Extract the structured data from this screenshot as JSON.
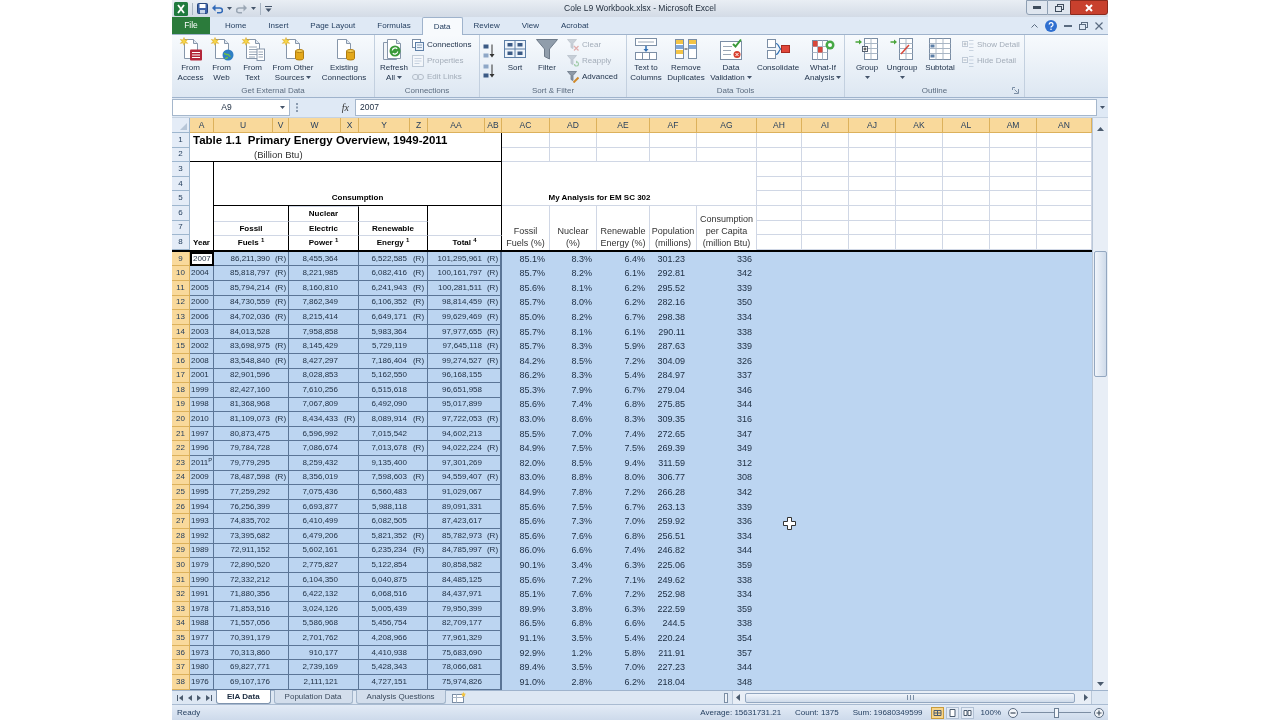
{
  "window": {
    "title": "Cole L9 Workbook.xlsx - Microsoft Excel"
  },
  "ribbon": {
    "tabs": [
      {
        "label": "File",
        "kind": "file",
        "selected": false
      },
      {
        "label": "Home",
        "kind": "tab",
        "selected": false
      },
      {
        "label": "Insert",
        "kind": "tab",
        "selected": false
      },
      {
        "label": "Page Layout",
        "kind": "tab",
        "selected": false
      },
      {
        "label": "Formulas",
        "kind": "tab",
        "selected": false
      },
      {
        "label": "Data",
        "kind": "tab",
        "selected": true
      },
      {
        "label": "Review",
        "kind": "tab",
        "selected": false
      },
      {
        "label": "View",
        "kind": "tab",
        "selected": false
      },
      {
        "label": "Acrobat",
        "kind": "tab",
        "selected": false
      }
    ],
    "groups": [
      {
        "label": "Get External Data",
        "launcher": false,
        "buttons": [
          {
            "label": "From Access",
            "kind": "large",
            "disabled": false
          },
          {
            "label": "From Web",
            "kind": "large",
            "disabled": false
          },
          {
            "label": "From Text",
            "kind": "large",
            "disabled": false
          },
          {
            "label": "From Other Sources",
            "kind": "menu",
            "disabled": false
          },
          {
            "label": "Existing Connections",
            "kind": "large",
            "disabled": false
          }
        ]
      },
      {
        "label": "Connections",
        "launcher": false,
        "buttons": [
          {
            "label": "Refresh All",
            "kind": "menu",
            "disabled": false
          },
          {
            "label": "Connections",
            "kind": "small",
            "disabled": false
          },
          {
            "label": "Properties",
            "kind": "small",
            "disabled": true
          },
          {
            "label": "Edit Links",
            "kind": "small",
            "disabled": true
          }
        ]
      },
      {
        "label": "Sort & Filter",
        "launcher": false,
        "buttons": [
          {
            "kind": "icon",
            "disabled": false
          },
          {
            "kind": "icon",
            "disabled": false
          },
          {
            "label": "Sort",
            "kind": "large",
            "disabled": false
          },
          {
            "label": "Filter",
            "kind": "large",
            "disabled": false
          },
          {
            "label": "Clear",
            "kind": "small",
            "disabled": true
          },
          {
            "label": "Reapply",
            "kind": "small",
            "disabled": true
          },
          {
            "label": "Advanced",
            "kind": "small",
            "disabled": false
          }
        ]
      },
      {
        "label": "Data Tools",
        "launcher": false,
        "buttons": [
          {
            "label": "Text to Columns",
            "kind": "large",
            "disabled": false
          },
          {
            "label": "Remove Duplicates",
            "kind": "large",
            "disabled": false
          },
          {
            "label": "Data Validation",
            "kind": "menu",
            "disabled": false
          },
          {
            "label": "Consolidate",
            "kind": "large",
            "disabled": false
          },
          {
            "label": "What-If Analysis",
            "kind": "menu",
            "disabled": false
          }
        ]
      },
      {
        "label": "Outline",
        "launcher": true,
        "buttons": [
          {
            "label": "Group",
            "kind": "split",
            "disabled": false
          },
          {
            "label": "Ungroup",
            "kind": "split",
            "disabled": false
          },
          {
            "label": "Subtotal",
            "kind": "large",
            "disabled": false
          },
          {
            "label": "Show Detail",
            "kind": "small",
            "disabled": true
          },
          {
            "label": "Hide Detail",
            "kind": "small",
            "disabled": true
          }
        ]
      }
    ]
  },
  "formula_bar": {
    "name_box": "A9",
    "function_label": "fx",
    "value": "2007"
  },
  "sheet": {
    "columns": [
      {
        "label": "A",
        "selected": true
      },
      {
        "label": "U",
        "selected": true
      },
      {
        "label": "V",
        "selected": true
      },
      {
        "label": "W",
        "selected": true
      },
      {
        "label": "X",
        "selected": true
      },
      {
        "label": "Y",
        "selected": true
      },
      {
        "label": "Z",
        "selected": true
      },
      {
        "label": "AA",
        "selected": true
      },
      {
        "label": "AB",
        "selected": true
      },
      {
        "label": "AC",
        "selected": true
      },
      {
        "label": "AD",
        "selected": true
      },
      {
        "label": "AE",
        "selected": true
      },
      {
        "label": "AF",
        "selected": true
      },
      {
        "label": "AG",
        "selected": true
      },
      {
        "label": "AH",
        "selected": true
      },
      {
        "label": "AI",
        "selected": true
      },
      {
        "label": "AJ",
        "selected": true
      },
      {
        "label": "AK",
        "selected": true
      },
      {
        "label": "AL",
        "selected": true
      },
      {
        "label": "AM",
        "selected": true
      },
      {
        "label": "AN",
        "selected": true
      }
    ],
    "header_rows": [
      {
        "label": "1",
        "selected": false
      },
      {
        "label": "2",
        "selected": false
      },
      {
        "label": "3",
        "selected": false
      },
      {
        "label": "4",
        "selected": false
      },
      {
        "label": "5",
        "selected": false
      },
      {
        "label": "6",
        "selected": false
      },
      {
        "label": "7",
        "selected": false
      },
      {
        "label": "8",
        "selected": false
      }
    ],
    "title": "Table 1.1  Primary Energy Overview, 1949-2011",
    "subtitle": "(Billion Btu)",
    "year_label": "Year",
    "group_label": "Consumption",
    "source_columns": [
      {
        "lines": [
          "Fossil",
          "Fuels $^{1}$"
        ]
      },
      {
        "lines": [
          "Nuclear",
          "Electric",
          "Power $^{1}$"
        ]
      },
      {
        "lines": [
          "Renewable",
          "Energy $^{1}$"
        ]
      },
      {
        "lines": [
          "Total $^{4}$"
        ]
      }
    ],
    "analysis_title": "My Analysis for EM SC 302",
    "analysis_columns": [
      "Fossil Fuels (%)",
      "Nuclear (%)",
      "Renewable Energy (%)",
      "Population (millions)",
      "Consumption per Capita (million Btu)"
    ],
    "rows": [
      {
        "row_number": "9",
        "year": "2007",
        "fossil": "86,211,390",
        "fossil_note": "(R)",
        "nuclear": "8,455,364",
        "renewable": "6,522,585",
        "renewable_note": "(R)",
        "total": "101,295,961",
        "total_note": "(R)",
        "fossil_pct": "85.1%",
        "nuclear_pct": "8.3%",
        "renewable_pct": "6.4%",
        "population": "301.23",
        "per_capita": "336",
        "selected": true,
        "active": true
      },
      {
        "row_number": "10",
        "year": "2004",
        "fossil": "85,818,797",
        "fossil_note": "(R)",
        "nuclear": "8,221,985",
        "renewable": "6,082,416",
        "renewable_note": "(R)",
        "total": "100,161,797",
        "total_note": "(R)",
        "fossil_pct": "85.7%",
        "nuclear_pct": "8.2%",
        "renewable_pct": "6.1%",
        "population": "292.81",
        "per_capita": "342",
        "selected": true,
        "active": false
      },
      {
        "row_number": "11",
        "year": "2005",
        "fossil": "85,794,214",
        "fossil_note": "(R)",
        "nuclear": "8,160,810",
        "renewable": "6,241,943",
        "renewable_note": "(R)",
        "total": "100,281,511",
        "total_note": "(R)",
        "fossil_pct": "85.6%",
        "nuclear_pct": "8.1%",
        "renewable_pct": "6.2%",
        "population": "295.52",
        "per_capita": "339",
        "selected": true,
        "active": false
      },
      {
        "row_number": "12",
        "year": "2000",
        "fossil": "84,730,559",
        "fossil_note": "(R)",
        "nuclear": "7,862,349",
        "renewable": "6,106,352",
        "renewable_note": "(R)",
        "total": "98,814,459",
        "total_note": "(R)",
        "fossil_pct": "85.7%",
        "nuclear_pct": "8.0%",
        "renewable_pct": "6.2%",
        "population": "282.16",
        "per_capita": "350",
        "selected": true,
        "active": false
      },
      {
        "row_number": "13",
        "year": "2006",
        "fossil": "84,702,036",
        "fossil_note": "(R)",
        "nuclear": "8,215,414",
        "renewable": "6,649,171",
        "renewable_note": "(R)",
        "total": "99,629,469",
        "total_note": "(R)",
        "fossil_pct": "85.0%",
        "nuclear_pct": "8.2%",
        "renewable_pct": "6.7%",
        "population": "298.38",
        "per_capita": "334",
        "selected": true,
        "active": false
      },
      {
        "row_number": "14",
        "year": "2003",
        "fossil": "84,013,528",
        "nuclear": "7,958,858",
        "renewable": "5,983,364",
        "total": "97,977,655",
        "total_note": "(R)",
        "fossil_pct": "85.7%",
        "nuclear_pct": "8.1%",
        "renewable_pct": "6.1%",
        "population": "290.11",
        "per_capita": "338",
        "selected": true,
        "active": false
      },
      {
        "row_number": "15",
        "year": "2002",
        "fossil": "83,698,975",
        "fossil_note": "(R)",
        "nuclear": "8,145,429",
        "renewable": "5,729,119",
        "total": "97,645,118",
        "total_note": "(R)",
        "fossil_pct": "85.7%",
        "nuclear_pct": "8.3%",
        "renewable_pct": "5.9%",
        "population": "287.63",
        "per_capita": "339",
        "selected": true,
        "active": false
      },
      {
        "row_number": "16",
        "year": "2008",
        "fossil": "83,548,840",
        "fossil_note": "(R)",
        "nuclear": "8,427,297",
        "renewable": "7,186,404",
        "renewable_note": "(R)",
        "total": "99,274,527",
        "total_note": "(R)",
        "fossil_pct": "84.2%",
        "nuclear_pct": "8.5%",
        "renewable_pct": "7.2%",
        "population": "304.09",
        "per_capita": "326",
        "selected": true,
        "active": false
      },
      {
        "row_number": "17",
        "year": "2001",
        "fossil": "82,901,596",
        "nuclear": "8,028,853",
        "renewable": "5,162,550",
        "total": "96,168,155",
        "fossil_pct": "86.2%",
        "nuclear_pct": "8.3%",
        "renewable_pct": "5.4%",
        "population": "284.97",
        "per_capita": "337",
        "selected": true,
        "active": false
      },
      {
        "row_number": "18",
        "year": "1999",
        "fossil": "82,427,160",
        "nuclear": "7,610,256",
        "renewable": "6,515,618",
        "total": "96,651,958",
        "fossil_pct": "85.3%",
        "nuclear_pct": "7.9%",
        "renewable_pct": "6.7%",
        "population": "279.04",
        "per_capita": "346",
        "selected": true,
        "active": false
      },
      {
        "row_number": "19",
        "year": "1998",
        "fossil": "81,368,968",
        "nuclear": "7,067,809",
        "renewable": "6,492,090",
        "total": "95,017,899",
        "fossil_pct": "85.6%",
        "nuclear_pct": "7.4%",
        "renewable_pct": "6.8%",
        "population": "275.85",
        "per_capita": "344",
        "selected": true,
        "active": false
      },
      {
        "row_number": "20",
        "year": "2010",
        "fossil": "81,109,073",
        "fossil_note": "(R)",
        "nuclear": "8,434,433",
        "nuclear_note": "(R)",
        "renewable": "8,089,914",
        "renewable_note": "(R)",
        "total": "97,722,053",
        "total_note": "(R)",
        "fossil_pct": "83.0%",
        "nuclear_pct": "8.6%",
        "renewable_pct": "8.3%",
        "population": "309.35",
        "per_capita": "316",
        "selected": true,
        "active": false
      },
      {
        "row_number": "21",
        "year": "1997",
        "fossil": "80,873,475",
        "nuclear": "6,596,992",
        "renewable": "7,015,542",
        "total": "94,602,213",
        "fossil_pct": "85.5%",
        "nuclear_pct": "7.0%",
        "renewable_pct": "7.4%",
        "population": "272.65",
        "per_capita": "347",
        "selected": true,
        "active": false
      },
      {
        "row_number": "22",
        "year": "1996",
        "fossil": "79,784,728",
        "nuclear": "7,086,674",
        "renewable": "7,013,678",
        "renewable_note": "(R)",
        "total": "94,022,224",
        "total_note": "(R)",
        "fossil_pct": "84.9%",
        "nuclear_pct": "7.5%",
        "renewable_pct": "7.5%",
        "population": "269.39",
        "per_capita": "349",
        "selected": true,
        "active": false
      },
      {
        "row_number": "23",
        "year": "2011$^{P}$",
        "fossil": "79,779,295",
        "nuclear": "8,259,432",
        "renewable": "9,135,400",
        "total": "97,301,269",
        "fossil_pct": "82.0%",
        "nuclear_pct": "8.5%",
        "renewable_pct": "9.4%",
        "population": "311.59",
        "per_capita": "312",
        "selected": true,
        "active": false
      },
      {
        "row_number": "24",
        "year": "2009",
        "fossil": "78,487,598",
        "fossil_note": "(R)",
        "nuclear": "8,356,019",
        "renewable": "7,598,603",
        "renewable_note": "(R)",
        "total": "94,559,407",
        "total_note": "(R)",
        "fossil_pct": "83.0%",
        "nuclear_pct": "8.8%",
        "renewable_pct": "8.0%",
        "population": "306.77",
        "per_capita": "308",
        "selected": true,
        "active": false
      },
      {
        "row_number": "25",
        "year": "1995",
        "fossil": "77,259,292",
        "nuclear": "7,075,436",
        "renewable": "6,560,483",
        "total": "91,029,067",
        "fossil_pct": "84.9%",
        "nuclear_pct": "7.8%",
        "renewable_pct": "7.2%",
        "population": "266.28",
        "per_capita": "342",
        "selected": true,
        "active": false
      },
      {
        "row_number": "26",
        "year": "1994",
        "fossil": "76,256,399",
        "nuclear": "6,693,877",
        "renewable": "5,988,118",
        "total": "89,091,331",
        "fossil_pct": "85.6%",
        "nuclear_pct": "7.5%",
        "renewable_pct": "6.7%",
        "population": "263.13",
        "per_capita": "339",
        "selected": true,
        "active": false
      },
      {
        "row_number": "27",
        "year": "1993",
        "fossil": "74,835,702",
        "nuclear": "6,410,499",
        "renewable": "6,082,505",
        "total": "87,423,617",
        "fossil_pct": "85.6%",
        "nuclear_pct": "7.3%",
        "renewable_pct": "7.0%",
        "population": "259.92",
        "per_capita": "336",
        "selected": true,
        "active": false
      },
      {
        "row_number": "28",
        "year": "1992",
        "fossil": "73,395,682",
        "nuclear": "6,479,206",
        "renewable": "5,821,352",
        "renewable_note": "(R)",
        "total": "85,782,973",
        "total_note": "(R)",
        "fossil_pct": "85.6%",
        "nuclear_pct": "7.6%",
        "renewable_pct": "6.8%",
        "population": "256.51",
        "per_capita": "334",
        "selected": true,
        "active": false
      },
      {
        "row_number": "29",
        "year": "1989",
        "fossil": "72,911,152",
        "nuclear": "5,602,161",
        "renewable": "6,235,234",
        "renewable_note": "(R)",
        "total": "84,785,997",
        "total_note": "(R)",
        "fossil_pct": "86.0%",
        "nuclear_pct": "6.6%",
        "renewable_pct": "7.4%",
        "population": "246.82",
        "per_capita": "344",
        "selected": true,
        "active": false
      },
      {
        "row_number": "30",
        "year": "1979",
        "fossil": "72,890,520",
        "nuclear": "2,775,827",
        "renewable": "5,122,854",
        "total": "80,858,582",
        "fossil_pct": "90.1%",
        "nuclear_pct": "3.4%",
        "renewable_pct": "6.3%",
        "population": "225.06",
        "per_capita": "359",
        "selected": true,
        "active": false
      },
      {
        "row_number": "31",
        "year": "1990",
        "fossil": "72,332,212",
        "nuclear": "6,104,350",
        "renewable": "6,040,875",
        "total": "84,485,125",
        "fossil_pct": "85.6%",
        "nuclear_pct": "7.2%",
        "renewable_pct": "7.1%",
        "population": "249.62",
        "per_capita": "338",
        "selected": true,
        "active": false
      },
      {
        "row_number": "32",
        "year": "1991",
        "fossil": "71,880,356",
        "nuclear": "6,422,132",
        "renewable": "6,068,516",
        "total": "84,437,971",
        "fossil_pct": "85.1%",
        "nuclear_pct": "7.6%",
        "renewable_pct": "7.2%",
        "population": "252.98",
        "per_capita": "334",
        "selected": true,
        "active": false
      },
      {
        "row_number": "33",
        "year": "1978",
        "fossil": "71,853,516",
        "nuclear": "3,024,126",
        "renewable": "5,005,439",
        "total": "79,950,399",
        "fossil_pct": "89.9%",
        "nuclear_pct": "3.8%",
        "renewable_pct": "6.3%",
        "population": "222.59",
        "per_capita": "359",
        "selected": true,
        "active": false
      },
      {
        "row_number": "34",
        "year": "1988",
        "fossil": "71,557,056",
        "nuclear": "5,586,968",
        "renewable": "5,456,754",
        "total": "82,709,177",
        "fossil_pct": "86.5%",
        "nuclear_pct": "6.8%",
        "renewable_pct": "6.6%",
        "population": "244.5",
        "per_capita": "338",
        "selected": true,
        "active": false
      },
      {
        "row_number": "35",
        "year": "1977",
        "fossil": "70,391,179",
        "nuclear": "2,701,762",
        "renewable": "4,208,966",
        "total": "77,961,329",
        "fossil_pct": "91.1%",
        "nuclear_pct": "3.5%",
        "renewable_pct": "5.4%",
        "population": "220.24",
        "per_capita": "354",
        "selected": true,
        "active": false
      },
      {
        "row_number": "36",
        "year": "1973",
        "fossil": "70,313,860",
        "nuclear": "910,177",
        "renewable": "4,410,938",
        "total": "75,683,690",
        "fossil_pct": "92.9%",
        "nuclear_pct": "1.2%",
        "renewable_pct": "5.8%",
        "population": "211.91",
        "per_capita": "357",
        "selected": true,
        "active": false
      },
      {
        "row_number": "37",
        "year": "1980",
        "fossil": "69,827,771",
        "nuclear": "2,739,169",
        "renewable": "5,428,343",
        "total": "78,066,681",
        "fossil_pct": "89.4%",
        "nuclear_pct": "3.5%",
        "renewable_pct": "7.0%",
        "population": "227.23",
        "per_capita": "344",
        "selected": true,
        "active": false
      },
      {
        "row_number": "38",
        "year": "1976",
        "fossil": "69,107,176",
        "nuclear": "2,111,121",
        "renewable": "4,727,151",
        "total": "75,974,826",
        "fossil_pct": "91.0%",
        "nuclear_pct": "2.8%",
        "renewable_pct": "6.2%",
        "population": "218.04",
        "per_capita": "348",
        "selected": true,
        "active": false
      }
    ]
  },
  "sheet_tabs": [
    {
      "label": "EIA Data",
      "selected": true
    },
    {
      "label": "Population Data",
      "selected": false
    },
    {
      "label": "Analysis Questions",
      "selected": false
    }
  ],
  "status_bar": {
    "status": "Ready",
    "average": "Average: 15631731.21",
    "count": "Count: 1375",
    "sum": "Sum: 19680349599",
    "views": [
      {
        "selected": true
      },
      {
        "selected": false
      },
      {
        "selected": false
      }
    ],
    "zoom": "100%",
    "zoom_slider": {
      "level": 0.5
    }
  }
}
